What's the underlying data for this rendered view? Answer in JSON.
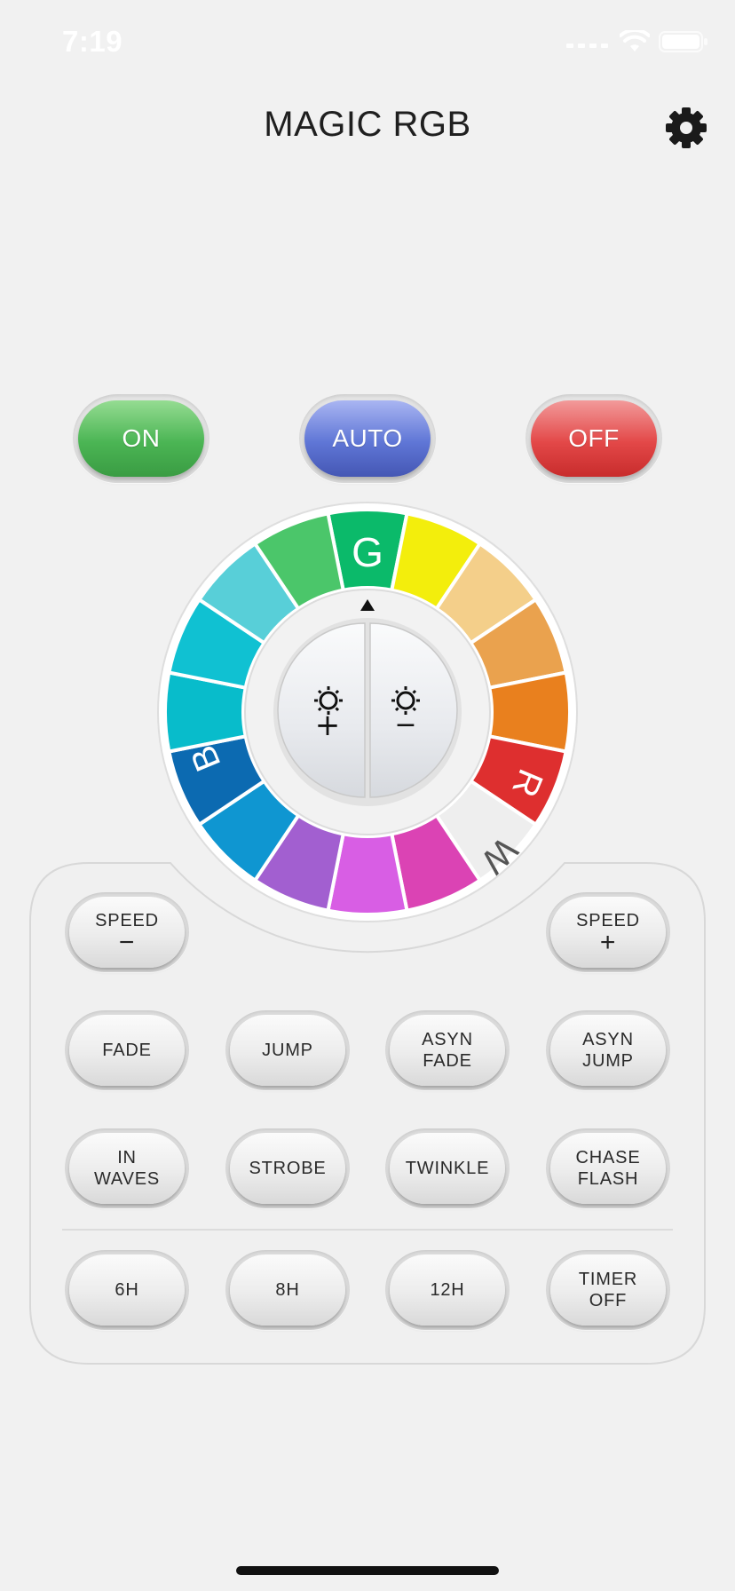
{
  "status_bar": {
    "time": "7:19"
  },
  "header": {
    "title": "MAGIC RGB",
    "settings_icon": "gear-icon"
  },
  "power": {
    "on_label": "ON",
    "auto_label": "AUTO",
    "off_label": "OFF",
    "colors": {
      "on": "#4bb554",
      "auto": "#5f76d6",
      "off": "#e34848"
    }
  },
  "wheel": {
    "labels": {
      "green": "G",
      "red": "R",
      "blue": "B",
      "white": "W"
    },
    "segments": [
      "#0bba6a",
      "#f3ee0c",
      "#f4cf8a",
      "#eaa24e",
      "#e9801e",
      "#de2f2f",
      "#eeeeee",
      "#db43b4",
      "#d85ee4",
      "#a25fd0",
      "#0f96d1",
      "#0c6ab1",
      "#08bccb",
      "#10c1d2",
      "#58cfd8",
      "#4bc66a"
    ],
    "brightness_up_symbol": "+",
    "brightness_down_symbol": "−",
    "brightness_icon": "sun-icon",
    "pointer_icon": "triangle-up-icon"
  },
  "speed": {
    "down_label": "SPEED",
    "down_symbol": "−",
    "up_label": "SPEED",
    "up_symbol": "+"
  },
  "modes": {
    "fade": "FADE",
    "jump": "JUMP",
    "asyn_fade_1": "ASYN",
    "asyn_fade_2": "FADE",
    "asyn_jump_1": "ASYN",
    "asyn_jump_2": "JUMP",
    "in_waves_1": "IN",
    "in_waves_2": "WAVES",
    "strobe": "STROBE",
    "twinkle": "TWINKLE",
    "chase_flash_1": "CHASE",
    "chase_flash_2": "FLASH"
  },
  "timers": {
    "h6": "6H",
    "h8": "8H",
    "h12": "12H",
    "timer_off_1": "TIMER",
    "timer_off_2": "OFF"
  }
}
